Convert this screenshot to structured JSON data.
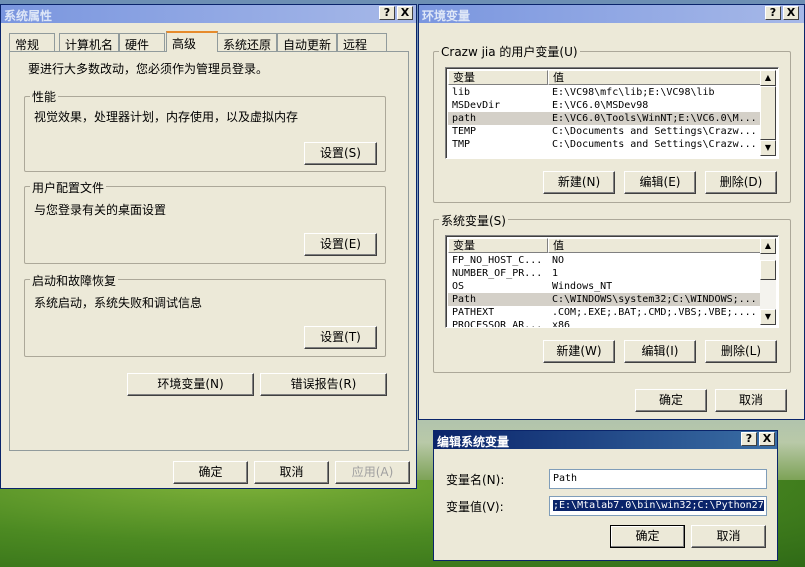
{
  "sys_props": {
    "title": "系统属性",
    "help_btn": "?",
    "close_btn": "X",
    "tabs": [
      {
        "label": "常规"
      },
      {
        "label": "计算机名"
      },
      {
        "label": "硬件"
      },
      {
        "label": "高级"
      },
      {
        "label": "系统还原"
      },
      {
        "label": "自动更新"
      },
      {
        "label": "远程"
      }
    ],
    "admin_notice": "要进行大多数改动，您必须作为管理员登录。",
    "performance": {
      "label": "性能",
      "desc": "视觉效果，处理器计划，内存使用，以及虚拟内存",
      "button": "设置(S)"
    },
    "profiles": {
      "label": "用户配置文件",
      "desc": "与您登录有关的桌面设置",
      "button": "设置(E)"
    },
    "startup": {
      "label": "启动和故障恢复",
      "desc": "系统启动，系统失败和调试信息",
      "button": "设置(T)"
    },
    "env_button": "环境变量(N)",
    "error_button": "错误报告(R)",
    "ok": "确定",
    "cancel": "取消",
    "apply": "应用(A)"
  },
  "env": {
    "title": "环境变量",
    "help_btn": "?",
    "close_btn": "X",
    "user_group": "Crazw jia 的用户变量(U)",
    "col_var": "变量",
    "col_val": "值",
    "user_vars": [
      {
        "name": "lib",
        "value": "E:\\VC98\\mfc\\lib;E:\\VC98\\lib"
      },
      {
        "name": "MSDevDir",
        "value": "E:\\VC6.0\\MSDev98"
      },
      {
        "name": "path",
        "value": "E:\\VC6.0\\Tools\\WinNT;E:\\VC6.0\\M..."
      },
      {
        "name": "TEMP",
        "value": "C:\\Documents and Settings\\Crazw..."
      },
      {
        "name": "TMP",
        "value": "C:\\Documents and Settings\\Crazw..."
      }
    ],
    "user_new": "新建(N)",
    "user_edit": "编辑(E)",
    "user_delete": "删除(D)",
    "sys_group": "系统变量(S)",
    "sys_vars": [
      {
        "name": "FP_NO_HOST_C...",
        "value": "NO"
      },
      {
        "name": "NUMBER_OF_PR...",
        "value": "1"
      },
      {
        "name": "OS",
        "value": "Windows_NT"
      },
      {
        "name": "Path",
        "value": "C:\\WINDOWS\\system32;C:\\WINDOWS;..."
      },
      {
        "name": "PATHEXT",
        "value": ".COM;.EXE;.BAT;.CMD;.VBS;.VBE;...."
      },
      {
        "name": "PROCESSOR_AR...",
        "value": "x86"
      }
    ],
    "sys_new": "新建(W)",
    "sys_edit": "编辑(I)",
    "sys_delete": "删除(L)",
    "ok": "确定",
    "cancel": "取消"
  },
  "edit_var": {
    "title": "编辑系统变量",
    "help_btn": "?",
    "close_btn": "X",
    "name_label": "变量名(N):",
    "name_value": "Path",
    "value_label": "变量值(V):",
    "value_value": ";E:\\Mtalab7.0\\bin\\win32;C:\\Python27",
    "ok": "确定",
    "cancel": "取消"
  }
}
